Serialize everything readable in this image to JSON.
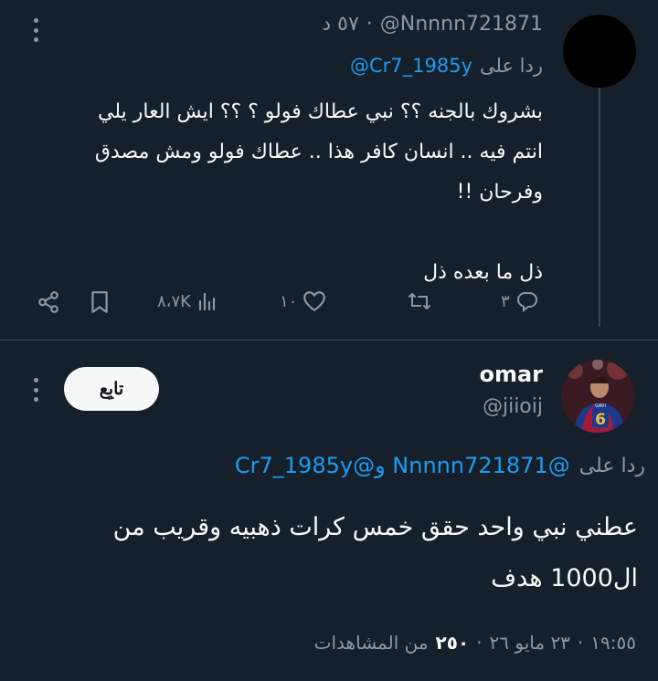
{
  "first_tweet": {
    "handle": "@Nnnnn721871",
    "time": "٥٧ د",
    "sep": "·",
    "reply_label": "ردا على",
    "reply_handle": "@Cr7_1985y",
    "lines": [
      "بشروك بالجنه ؟؟ نبي عطاك فولو ؟ ؟؟ ايش العار يلي",
      "انتم فيه .. انسان كافر هذا .. عطاك فولو ومش مصدق",
      "وفرحان !!",
      "",
      "ذل ما بعده ذل"
    ],
    "actions": {
      "replies": "٣",
      "retweets": "",
      "likes": "١٠",
      "views": "٨،٧K"
    }
  },
  "reply_tweet": {
    "name": "omar",
    "handle": "@jiioij",
    "follow_label": "تابِع",
    "reply_label": "ردا على",
    "reply_handles": "@Nnnnn721871 و@Cr7_1985y",
    "lines": [
      "عطني نبي واحد حقق خمس كرات ذهبيه وقريب من",
      "ال1000 هدف"
    ],
    "meta": {
      "time": "١٩:٥٥",
      "date": "٢٣ مايو ٢٦",
      "views_count": "٢٥٠",
      "views_label": "من المشاهدات"
    }
  },
  "colors": {
    "background": "#15202b",
    "accent": "#1d9bf0",
    "muted": "#8b98a5"
  },
  "icons": [
    "more-icon",
    "reply-icon",
    "retweet-icon",
    "like-icon",
    "views-icon",
    "bookmark-icon",
    "share-icon"
  ]
}
